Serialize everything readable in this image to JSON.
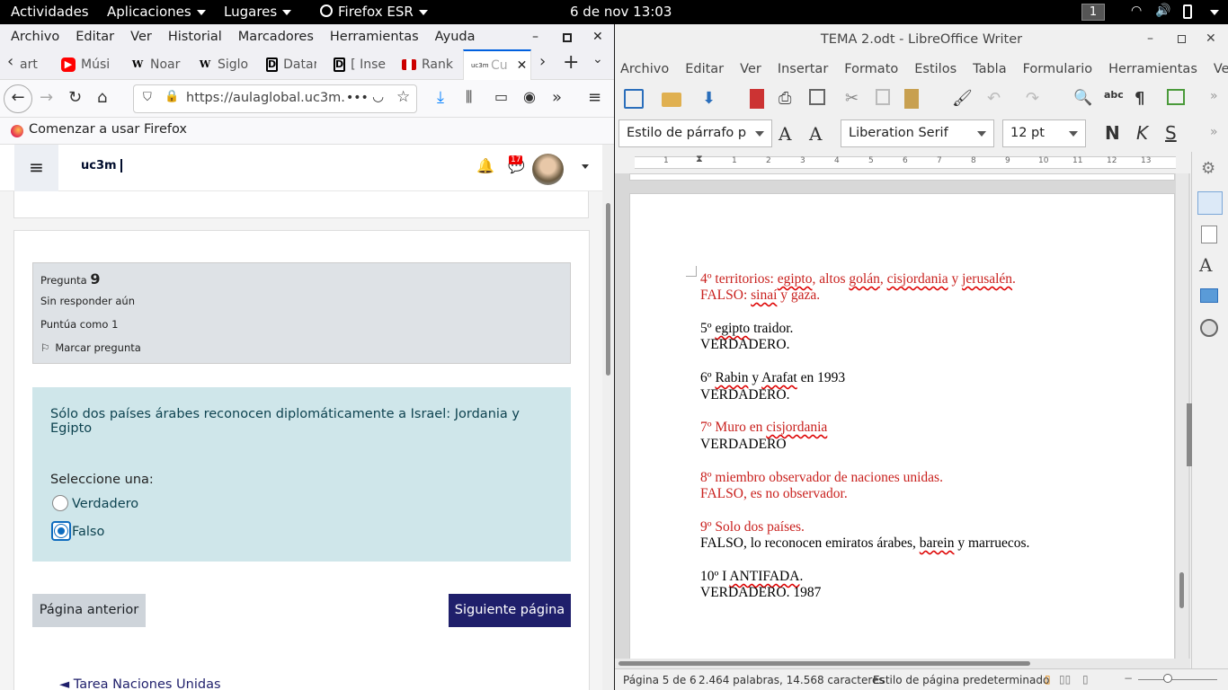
{
  "topbar": {
    "activities": "Actividades",
    "applications": "Aplicaciones",
    "places": "Lugares",
    "app": "Firefox ESR",
    "clock": "6 de nov  13:03",
    "workspace": "1"
  },
  "firefox": {
    "menu": [
      "Archivo",
      "Editar",
      "Ver",
      "Historial",
      "Marcadores",
      "Herramientas",
      "Ayuda"
    ],
    "tabs": [
      {
        "label": "art",
        "icon": "generic"
      },
      {
        "label": "Músi",
        "icon": "youtube"
      },
      {
        "label": "Noar",
        "icon": "wikipedia"
      },
      {
        "label": "Siglo",
        "icon": "wikipedia"
      },
      {
        "label": "Datar",
        "icon": "d"
      },
      {
        "label": "[ Inse",
        "icon": "d"
      },
      {
        "label": "Rank",
        "icon": "flag"
      },
      {
        "label": "Cu",
        "icon": "uc3m"
      }
    ],
    "url": "https://aulaglobal.uc3m.",
    "bookmark": "Comenzar a usar Firefox",
    "moodle": {
      "logo": "uc3m",
      "notification_count": "17"
    },
    "question": {
      "label": "Pregunta",
      "number": "9",
      "status": "Sin responder aún",
      "score": "Puntúa como 1",
      "flag": "Marcar pregunta",
      "text": "Sólo dos países árabes reconocen diplomáticamente a Israel: Jordania y Egipto",
      "prompt": "Seleccione una:",
      "options": [
        "Verdadero",
        "Falso"
      ],
      "selected": 1
    },
    "buttons": {
      "prev": "Página anterior",
      "next": "Siguiente página"
    },
    "backlink": "◄ Tarea Naciones Unidas"
  },
  "writer": {
    "title": "TEMA 2.odt - LibreOffice Writer",
    "menu": [
      "Archivo",
      "Editar",
      "Ver",
      "Insertar",
      "Formato",
      "Estilos",
      "Tabla",
      "Formulario",
      "Herramientas",
      "Ventana"
    ],
    "para_style": "Estilo de párrafo p",
    "font": "Liberation Serif",
    "size": "12 pt",
    "format_buttons": [
      "N",
      "K",
      "S"
    ],
    "ruler": [
      "1",
      "1",
      "2",
      "3",
      "4",
      "5",
      "6",
      "7",
      "8",
      "9",
      "10",
      "11",
      "12",
      "13"
    ],
    "lines": [
      {
        "text": "4º territorios: egipto, altos golán, cisjordania y jerusalén.",
        "red": true
      },
      {
        "text": "FALSO: sinaí y gaza.",
        "red": true
      },
      {
        "text": "5º egipto traidor.",
        "red": false
      },
      {
        "text": "VERDADERO.",
        "red": false
      },
      {
        "text": "6º Rabin y Arafat en 1993",
        "red": false
      },
      {
        "text": "VERDADERO.",
        "red": false
      },
      {
        "text": "7º Muro en cisjordania",
        "red": true
      },
      {
        "text": "VERDADERO",
        "red": false
      },
      {
        "text": "8º miembro observador de naciones unidas.",
        "red": true
      },
      {
        "text": "FALSO, es no observador.",
        "red": true
      },
      {
        "text": "9º Solo dos países.",
        "red": true
      },
      {
        "text": "FALSO, lo reconocen emiratos árabes, barein y marruecos.",
        "red": false
      },
      {
        "text": "10º I ANTIFADA.",
        "red": false
      },
      {
        "text": "VERDADERO. 1987",
        "red": false
      }
    ],
    "status": {
      "page": "Página 5 de 6",
      "words": "2.464 palabras, 14.568 caracteres",
      "style": "Estilo de página predeterminado"
    }
  }
}
